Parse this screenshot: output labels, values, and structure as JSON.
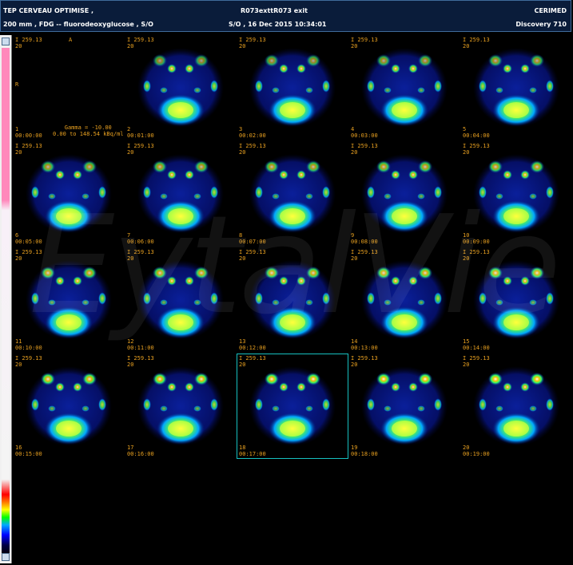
{
  "header": {
    "exam_title": "TEP CERVEAU OPTIMISE ,",
    "exam_details": "200 mm , FDG -- fluorodeoxyglucose , S/O",
    "patient_id": "R073exttR073 exit",
    "patient_date": "S/O , 16 Dec 2015 10:34:01",
    "institution": "CERIMED",
    "scanner": "Discovery 710"
  },
  "orientation": {
    "right": "R",
    "anterior": "A"
  },
  "gamma_line1": "Gamma = -10.00",
  "gamma_line2": "0.00 to 148.54 kBq/ml",
  "watermark": "EytalVie",
  "frames": [
    {
      "top_line1": "I 259.13",
      "top_line2": "20",
      "index": "1",
      "time": "00:00:00",
      "empty": true
    },
    {
      "top_line1": "I 259.13",
      "top_line2": "20",
      "index": "2",
      "time": "00:01:00",
      "empty": false
    },
    {
      "top_line1": "I 259.13",
      "top_line2": "20",
      "index": "3",
      "time": "00:02:00",
      "empty": false
    },
    {
      "top_line1": "I 259.13",
      "top_line2": "20",
      "index": "4",
      "time": "00:03:00",
      "empty": false
    },
    {
      "top_line1": "I 259.13",
      "top_line2": "20",
      "index": "5",
      "time": "00:04:00",
      "empty": false
    },
    {
      "top_line1": "I 259.13",
      "top_line2": "20",
      "index": "6",
      "time": "00:05:00",
      "empty": false
    },
    {
      "top_line1": "I 259.13",
      "top_line2": "20",
      "index": "7",
      "time": "00:06:00",
      "empty": false
    },
    {
      "top_line1": "I 259.13",
      "top_line2": "20",
      "index": "8",
      "time": "00:07:00",
      "empty": false
    },
    {
      "top_line1": "I 259.13",
      "top_line2": "20",
      "index": "9",
      "time": "00:08:00",
      "empty": false
    },
    {
      "top_line1": "I 259.13",
      "top_line2": "20",
      "index": "10",
      "time": "00:09:00",
      "empty": false
    },
    {
      "top_line1": "I 259.13",
      "top_line2": "20",
      "index": "11",
      "time": "00:10:00",
      "empty": false
    },
    {
      "top_line1": "I 259.13",
      "top_line2": "20",
      "index": "12",
      "time": "00:11:00",
      "empty": false
    },
    {
      "top_line1": "I 259.13",
      "top_line2": "20",
      "index": "13",
      "time": "00:12:00",
      "empty": false
    },
    {
      "top_line1": "I 259.13",
      "top_line2": "20",
      "index": "14",
      "time": "00:13:00",
      "empty": false
    },
    {
      "top_line1": "I 259.13",
      "top_line2": "20",
      "index": "15",
      "time": "00:14:00",
      "empty": false
    },
    {
      "top_line1": "I 259.13",
      "top_line2": "20",
      "index": "16",
      "time": "00:15:00",
      "empty": false
    },
    {
      "top_line1": "I 259.13",
      "top_line2": "20",
      "index": "17",
      "time": "00:16:00",
      "empty": false
    },
    {
      "top_line1": "I 259.13",
      "top_line2": "20",
      "index": "18",
      "time": "00:17:00",
      "empty": false,
      "selected": true
    },
    {
      "top_line1": "I 259.13",
      "top_line2": "20",
      "index": "19",
      "time": "00:18:00",
      "empty": false
    },
    {
      "top_line1": "I 259.13",
      "top_line2": "20",
      "index": "20",
      "time": "00:19:00",
      "empty": false
    }
  ],
  "colors": {
    "label": "#e8a020",
    "header_bg": "#0a1c3a",
    "selection": "#16c0c0"
  }
}
